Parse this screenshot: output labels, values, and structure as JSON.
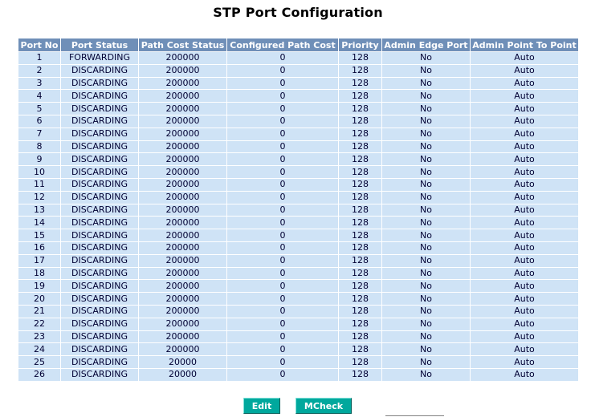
{
  "page": {
    "title": "STP Port Configuration"
  },
  "table": {
    "headers": [
      "Port No",
      "Port Status",
      "Path Cost Status",
      "Configured Path Cost",
      "Priority",
      "Admin Edge Port",
      "Admin Point To Point"
    ],
    "rows": [
      [
        "1",
        "FORWARDING",
        "200000",
        "0",
        "128",
        "No",
        "Auto"
      ],
      [
        "2",
        "DISCARDING",
        "200000",
        "0",
        "128",
        "No",
        "Auto"
      ],
      [
        "3",
        "DISCARDING",
        "200000",
        "0",
        "128",
        "No",
        "Auto"
      ],
      [
        "4",
        "DISCARDING",
        "200000",
        "0",
        "128",
        "No",
        "Auto"
      ],
      [
        "5",
        "DISCARDING",
        "200000",
        "0",
        "128",
        "No",
        "Auto"
      ],
      [
        "6",
        "DISCARDING",
        "200000",
        "0",
        "128",
        "No",
        "Auto"
      ],
      [
        "7",
        "DISCARDING",
        "200000",
        "0",
        "128",
        "No",
        "Auto"
      ],
      [
        "8",
        "DISCARDING",
        "200000",
        "0",
        "128",
        "No",
        "Auto"
      ],
      [
        "9",
        "DISCARDING",
        "200000",
        "0",
        "128",
        "No",
        "Auto"
      ],
      [
        "10",
        "DISCARDING",
        "200000",
        "0",
        "128",
        "No",
        "Auto"
      ],
      [
        "11",
        "DISCARDING",
        "200000",
        "0",
        "128",
        "No",
        "Auto"
      ],
      [
        "12",
        "DISCARDING",
        "200000",
        "0",
        "128",
        "No",
        "Auto"
      ],
      [
        "13",
        "DISCARDING",
        "200000",
        "0",
        "128",
        "No",
        "Auto"
      ],
      [
        "14",
        "DISCARDING",
        "200000",
        "0",
        "128",
        "No",
        "Auto"
      ],
      [
        "15",
        "DISCARDING",
        "200000",
        "0",
        "128",
        "No",
        "Auto"
      ],
      [
        "16",
        "DISCARDING",
        "200000",
        "0",
        "128",
        "No",
        "Auto"
      ],
      [
        "17",
        "DISCARDING",
        "200000",
        "0",
        "128",
        "No",
        "Auto"
      ],
      [
        "18",
        "DISCARDING",
        "200000",
        "0",
        "128",
        "No",
        "Auto"
      ],
      [
        "19",
        "DISCARDING",
        "200000",
        "0",
        "128",
        "No",
        "Auto"
      ],
      [
        "20",
        "DISCARDING",
        "200000",
        "0",
        "128",
        "No",
        "Auto"
      ],
      [
        "21",
        "DISCARDING",
        "200000",
        "0",
        "128",
        "No",
        "Auto"
      ],
      [
        "22",
        "DISCARDING",
        "200000",
        "0",
        "128",
        "No",
        "Auto"
      ],
      [
        "23",
        "DISCARDING",
        "200000",
        "0",
        "128",
        "No",
        "Auto"
      ],
      [
        "24",
        "DISCARDING",
        "200000",
        "0",
        "128",
        "No",
        "Auto"
      ],
      [
        "25",
        "DISCARDING",
        "20000",
        "0",
        "128",
        "No",
        "Auto"
      ],
      [
        "26",
        "DISCARDING",
        "20000",
        "0",
        "128",
        "No",
        "Auto"
      ]
    ]
  },
  "buttons": {
    "edit_label": "Edit",
    "mcheck_label": "MCheck"
  },
  "colors": {
    "header_bg": "#6f8fb8",
    "row_bg": "#cfe3f6",
    "button_bg": "#00a89d"
  }
}
